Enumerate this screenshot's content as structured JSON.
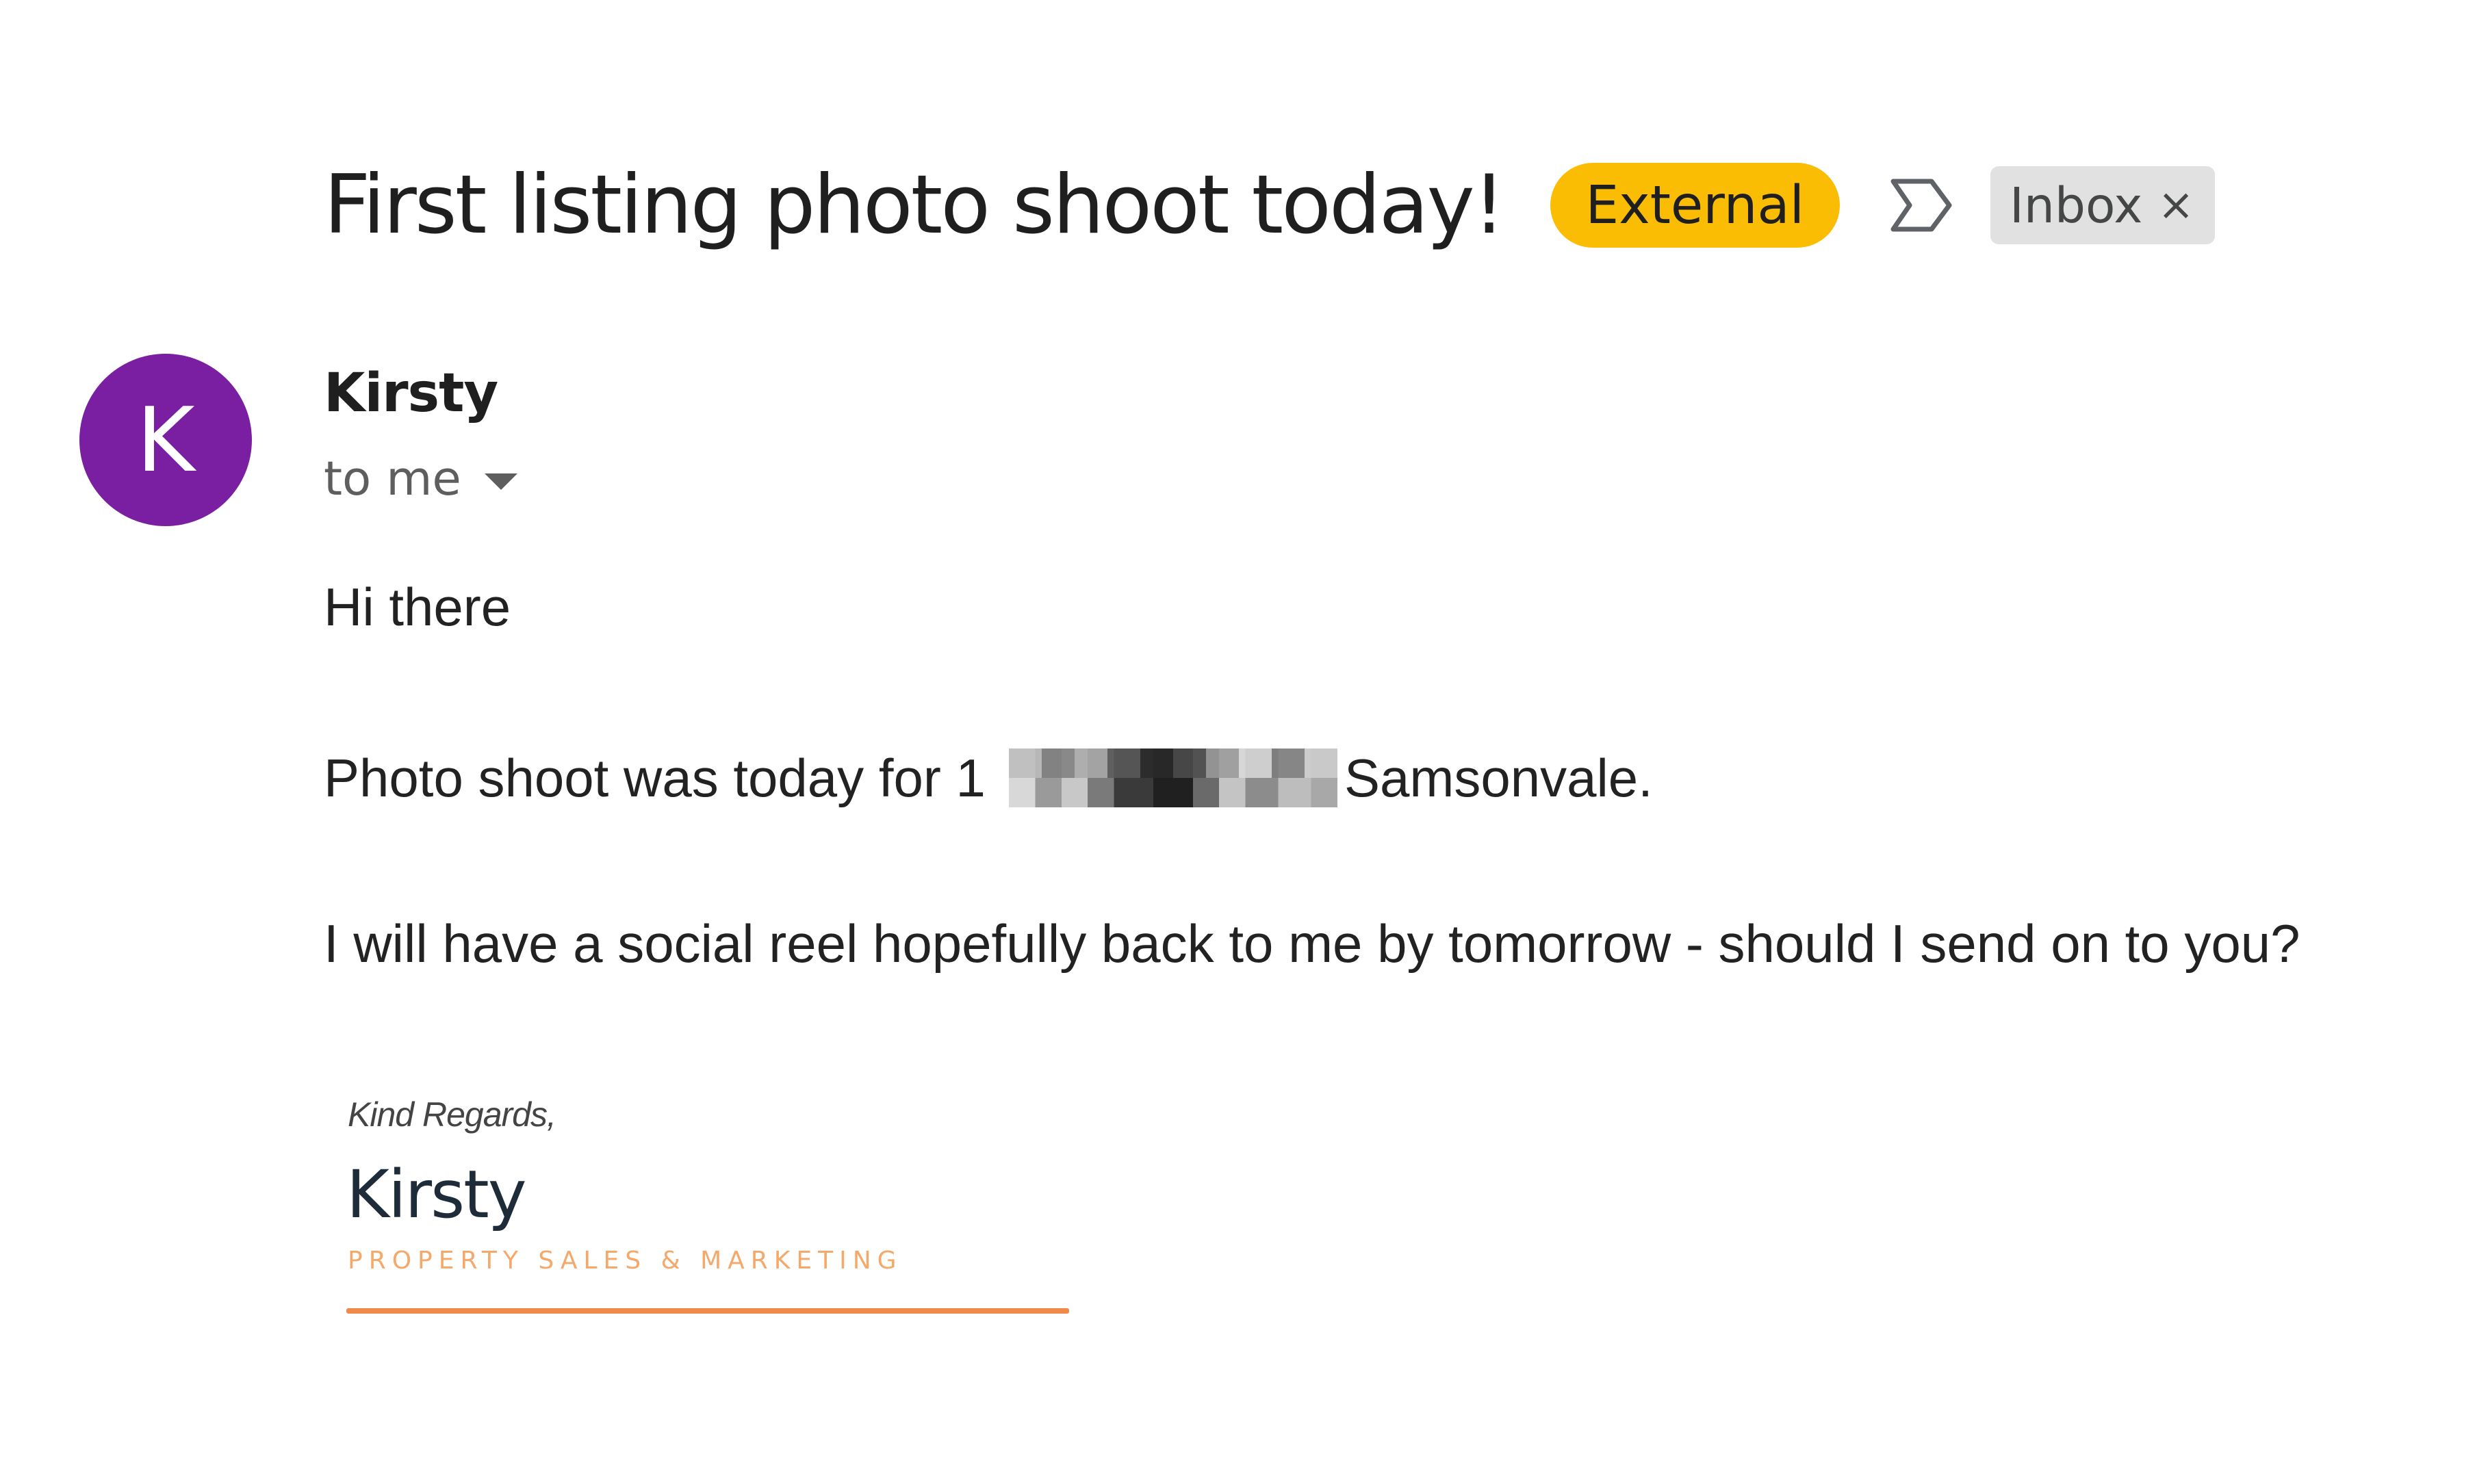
{
  "email": {
    "subject": "First listing photo shoot today!",
    "labels": {
      "external": "External",
      "inbox": "Inbox",
      "inbox_remove": "×"
    },
    "sender": {
      "avatar_initial": "K",
      "avatar_color": "#7b1fa2",
      "name": "Kirsty",
      "recipient": "to me"
    },
    "body": {
      "greeting": "Hi there",
      "line2_prefix": "Photo shoot was today for 1",
      "line2_suffix": "Samsonvale.",
      "line3": "I will have a social reel hopefully back to me by tomorrow - should I send on to you?"
    },
    "signature": {
      "closing": "Kind Regards,",
      "name": "Kirsty",
      "tagline": "PROPERTY SALES & MARKETING"
    }
  },
  "colors": {
    "external_chip": "#fbbc04",
    "inbox_chip": "#e1e1e1",
    "signature_accent": "#f08a4b"
  },
  "icons": {
    "label": "label-outline-icon",
    "dropdown": "arrow-drop-down-icon"
  }
}
